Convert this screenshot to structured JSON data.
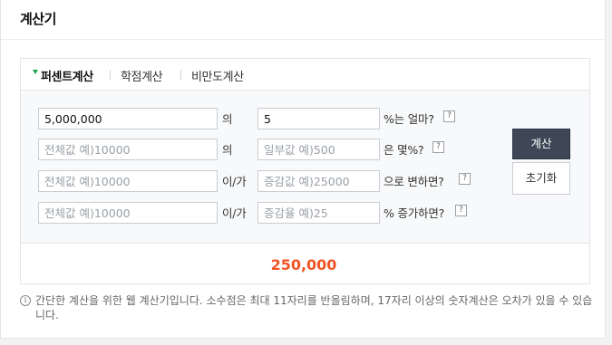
{
  "header": {
    "title": "계산기"
  },
  "tabs": [
    {
      "label": "퍼센트계산",
      "active": true
    },
    {
      "label": "학점계산",
      "active": false
    },
    {
      "label": "비만도계산",
      "active": false
    }
  ],
  "rows": [
    {
      "input1": {
        "value": "5,000,000",
        "placeholder": ""
      },
      "mid": "의",
      "input2": {
        "value": "5",
        "placeholder": ""
      },
      "suffix": "%는 얼마?"
    },
    {
      "input1": {
        "value": "",
        "placeholder": "전체값 예)10000"
      },
      "mid": "의",
      "input2": {
        "value": "",
        "placeholder": "일부값 예)500"
      },
      "suffix": "은 몇%?"
    },
    {
      "input1": {
        "value": "",
        "placeholder": "전체값 예)10000"
      },
      "mid": "이/가",
      "input2": {
        "value": "",
        "placeholder": "증감값 예)25000"
      },
      "suffix": "으로 변하면?"
    },
    {
      "input1": {
        "value": "",
        "placeholder": "전체값 예)10000"
      },
      "mid": "이/가",
      "input2": {
        "value": "",
        "placeholder": "증감율 예)25"
      },
      "suffix": "% 증가하면?"
    }
  ],
  "help_glyph": "?",
  "buttons": {
    "calculate": "계산",
    "reset": "초기화"
  },
  "result": "250,000",
  "notice": "간단한 계산을 위한 웹 계산기입니다. 소수점은 최대 11자리를 반올림하며, 17자리 이상의 숫자계산은 오차가 있을 수 있습니다.",
  "info_glyph": "i",
  "colors": {
    "result": "#f05423",
    "primary_button": "#3d4756",
    "tab_marker": "#16a34a"
  }
}
